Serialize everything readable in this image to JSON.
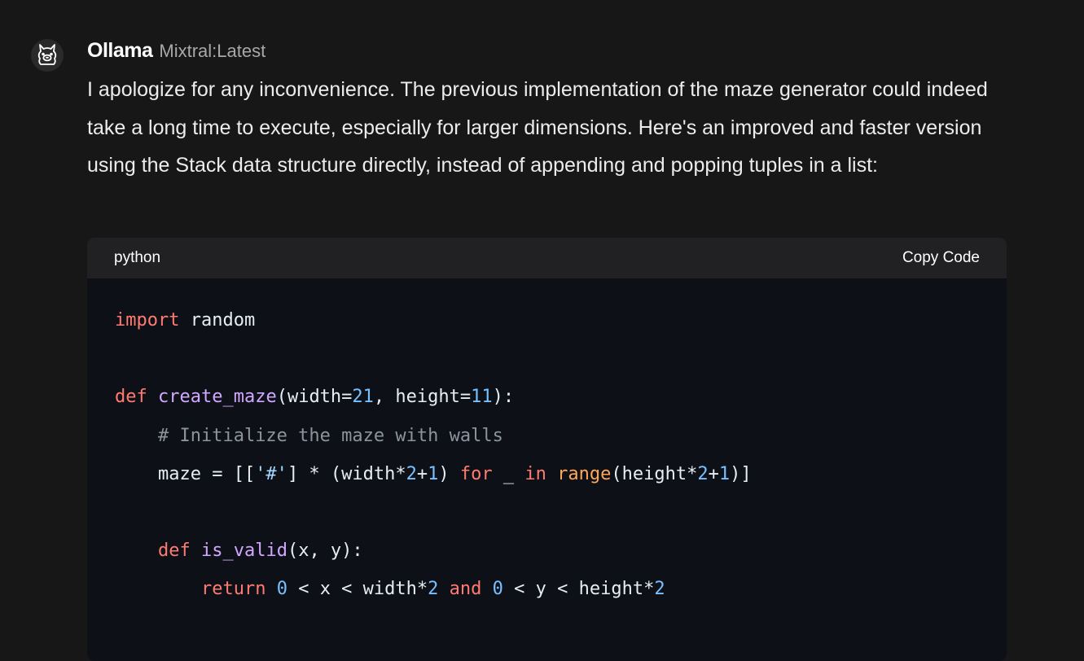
{
  "message": {
    "sender": "Ollama",
    "model": "Mixtral:Latest",
    "avatar_icon": "llama-icon",
    "text": "I apologize for any inconvenience. The previous implementation of the maze generator could indeed take a long time to execute, especially for larger dimensions. Here's an improved and faster version using the Stack data structure directly, instead of appending and popping tuples in a list:"
  },
  "code_block": {
    "language": "python",
    "copy_label": "Copy Code",
    "lines": [
      [
        {
          "t": "import",
          "c": "keyword"
        },
        {
          "t": " random",
          "c": "plain"
        }
      ],
      [],
      [
        {
          "t": "def",
          "c": "keyword"
        },
        {
          "t": " ",
          "c": "plain"
        },
        {
          "t": "create_maze",
          "c": "func"
        },
        {
          "t": "(width=",
          "c": "plain"
        },
        {
          "t": "21",
          "c": "num"
        },
        {
          "t": ", height=",
          "c": "plain"
        },
        {
          "t": "11",
          "c": "num"
        },
        {
          "t": "):",
          "c": "plain"
        }
      ],
      [
        {
          "t": "    ",
          "c": "plain"
        },
        {
          "t": "# Initialize the maze with walls",
          "c": "comment"
        }
      ],
      [
        {
          "t": "    maze = [[",
          "c": "plain"
        },
        {
          "t": "'#'",
          "c": "str"
        },
        {
          "t": "] * (width*",
          "c": "plain"
        },
        {
          "t": "2",
          "c": "num"
        },
        {
          "t": "+",
          "c": "plain"
        },
        {
          "t": "1",
          "c": "num"
        },
        {
          "t": ") ",
          "c": "plain"
        },
        {
          "t": "for",
          "c": "keyword"
        },
        {
          "t": " _ ",
          "c": "plain"
        },
        {
          "t": "in",
          "c": "keyword"
        },
        {
          "t": " ",
          "c": "plain"
        },
        {
          "t": "range",
          "c": "builtin"
        },
        {
          "t": "(height*",
          "c": "plain"
        },
        {
          "t": "2",
          "c": "num"
        },
        {
          "t": "+",
          "c": "plain"
        },
        {
          "t": "1",
          "c": "num"
        },
        {
          "t": ")]",
          "c": "plain"
        }
      ],
      [],
      [
        {
          "t": "    ",
          "c": "plain"
        },
        {
          "t": "def",
          "c": "keyword"
        },
        {
          "t": " ",
          "c": "plain"
        },
        {
          "t": "is_valid",
          "c": "func"
        },
        {
          "t": "(x, y):",
          "c": "plain"
        }
      ],
      [
        {
          "t": "        ",
          "c": "plain"
        },
        {
          "t": "return",
          "c": "keyword"
        },
        {
          "t": " ",
          "c": "plain"
        },
        {
          "t": "0",
          "c": "num"
        },
        {
          "t": " < x < width*",
          "c": "plain"
        },
        {
          "t": "2",
          "c": "num"
        },
        {
          "t": " ",
          "c": "plain"
        },
        {
          "t": "and",
          "c": "keyword"
        },
        {
          "t": " ",
          "c": "plain"
        },
        {
          "t": "0",
          "c": "num"
        },
        {
          "t": " < y < height*",
          "c": "plain"
        },
        {
          "t": "2",
          "c": "num"
        }
      ]
    ]
  }
}
